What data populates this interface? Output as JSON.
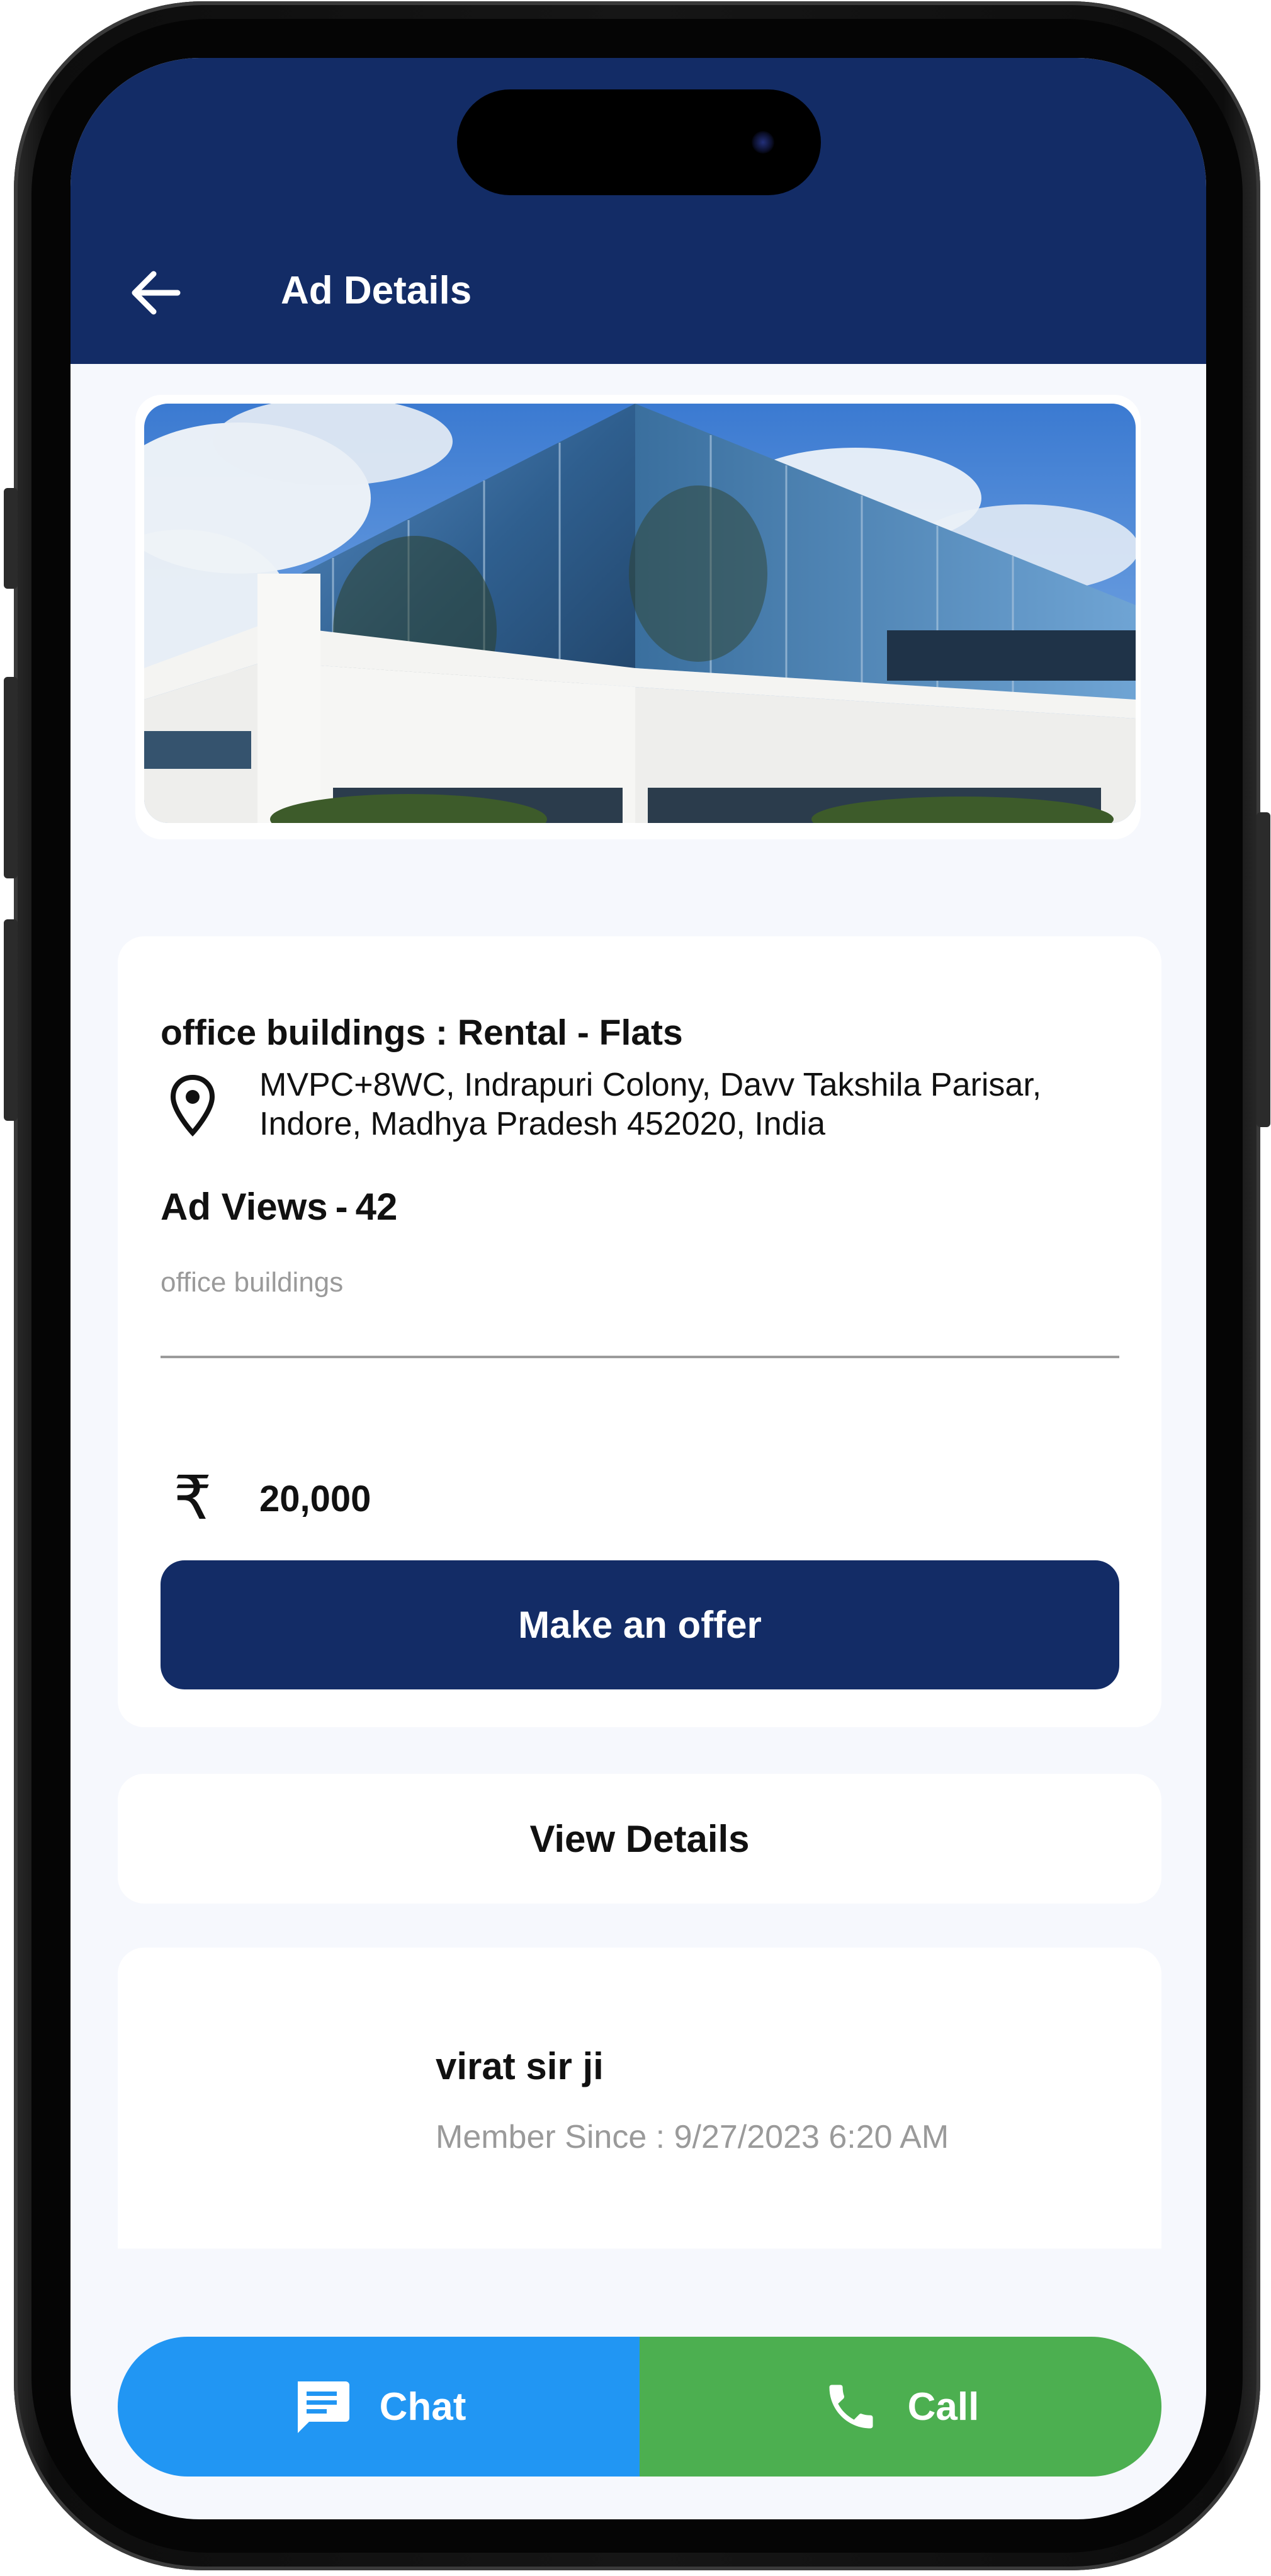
{
  "app_bar": {
    "title": "Ad Details",
    "back_icon": "arrow-left-icon",
    "background_color": "#132c66"
  },
  "listing": {
    "image_description_icon": "office-building-photo",
    "title": "office buildings : Rental - Flats",
    "address": "MVPC+8WC, Indrapuri Colony, Davv Takshila Parisar, Indore, Madhya Pradesh 452020, India",
    "views_label": "Ad Views",
    "views_separator": "-",
    "views_count": "42",
    "category": "office buildings",
    "currency_symbol": "₹",
    "price": "20,000",
    "offer_button_label": "Make an offer"
  },
  "details": {
    "label": "View Details"
  },
  "seller": {
    "name": "virat sir ji",
    "member_since": "Member Since : 9/27/2023 6:20 AM"
  },
  "actions": {
    "chat_label": "Chat",
    "chat_icon": "chat-message-icon",
    "chat_color": "#2196f3",
    "call_label": "Call",
    "call_icon": "phone-icon",
    "call_color": "#4caf50"
  }
}
